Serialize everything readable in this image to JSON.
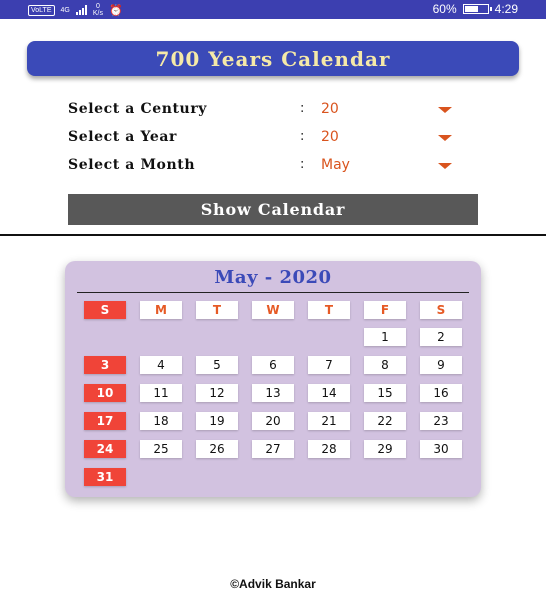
{
  "status_bar": {
    "network_tag": "VoLTE",
    "network_type": "4G",
    "speed_value": "0",
    "speed_unit": "K/s",
    "alarm_icon": "alarm-clock-icon",
    "battery_percent": "60%",
    "battery_level": 0.6,
    "time": "4:29"
  },
  "header": {
    "title": "700 Years Calendar"
  },
  "form": {
    "century": {
      "label": "Select a Century",
      "colon": ":",
      "value": "20"
    },
    "year": {
      "label": "Select a Year",
      "colon": ":",
      "value": "20"
    },
    "month": {
      "label": "Select a Month",
      "colon": ":",
      "value": "May"
    },
    "show_button": "Show Calendar"
  },
  "calendar": {
    "title": "May - 2020",
    "weekdays": [
      "S",
      "M",
      "T",
      "W",
      "T",
      "F",
      "S"
    ],
    "weeks": [
      [
        "",
        "",
        "",
        "",
        "",
        "1",
        "2"
      ],
      [
        "3",
        "4",
        "5",
        "6",
        "7",
        "8",
        "9"
      ],
      [
        "10",
        "11",
        "12",
        "13",
        "14",
        "15",
        "16"
      ],
      [
        "17",
        "18",
        "19",
        "20",
        "21",
        "22",
        "23"
      ],
      [
        "24",
        "25",
        "26",
        "27",
        "28",
        "29",
        "30"
      ],
      [
        "31",
        "",
        "",
        "",
        "",
        "",
        ""
      ]
    ]
  },
  "footer": {
    "text": "©Advik Bankar"
  },
  "colors": {
    "status_bar": "#3c3fb0",
    "banner": "#3b4ab8",
    "banner_text": "#f5e9a8",
    "dropdown_value": "#d9541e",
    "button": "#585858",
    "calendar_bg": "#d2c2e0",
    "sunday": "#f04438"
  }
}
